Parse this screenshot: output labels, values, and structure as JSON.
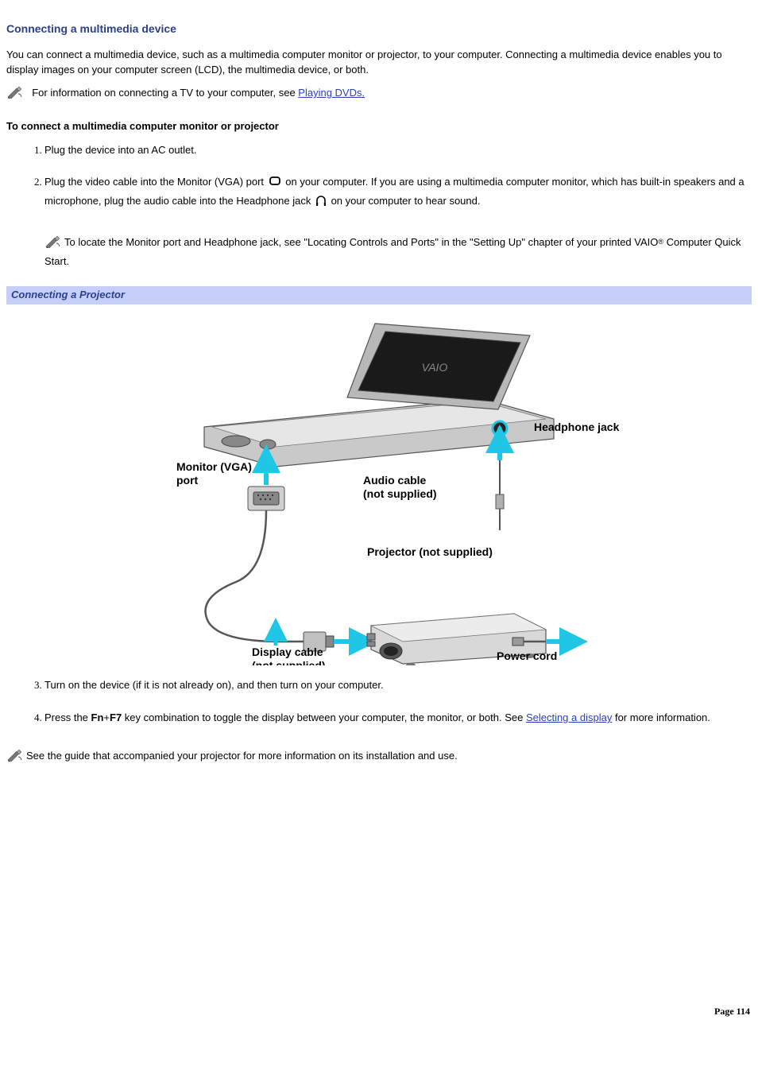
{
  "heading": "Connecting a multimedia device",
  "intro": "You can connect a multimedia device, such as a multimedia computer monitor or projector, to your computer. Connecting a multimedia device enables you to display images on your computer screen (LCD), the multimedia device, or both.",
  "tvNote_pre": "For information on connecting a TV to your computer, see ",
  "tvNote_link": "Playing DVDs.",
  "sectionTitle": "To connect a multimedia computer monitor or projector",
  "step1": "Plug the device into an AC outlet.",
  "step2_a": "Plug the video cable into the Monitor (VGA) port ",
  "step2_b": " on your computer. If you are using a multimedia computer monitor, which has built-in speakers and a microphone, plug the audio cable into the Headphone jack ",
  "step2_c": " on your computer to hear sound.",
  "step2_note_a": "To locate the Monitor port and Headphone jack, see \"Locating Controls and Ports\" in the \"Setting Up\" chapter of your printed VAIO",
  "step2_note_reg": "®",
  "step2_note_b": " Computer Quick Start.",
  "figureCaption": "Connecting a Projector",
  "diagram": {
    "monitorPort_l1": "Monitor (VGA)",
    "monitorPort_l2": "port",
    "headphoneJack": "Headphone jack",
    "audioCable_l1": "Audio cable",
    "audioCable_l2": "(not supplied)",
    "projector": "Projector (not supplied)",
    "displayCable_l1": "Display cable",
    "displayCable_l2": "(not supplied)",
    "powerCord": "Power cord"
  },
  "step3": "Turn on the device (if it is not already on), and then turn on your computer.",
  "step4_a": "Press the ",
  "step4_fn": "Fn",
  "step4_plus": "+",
  "step4_f7": "F7",
  "step4_b": " key combination to toggle the display between your computer, the monitor, or both. See ",
  "step4_link": "Selecting a display",
  "step4_c": " for more information.",
  "finalNote": "See the guide that accompanied your projector for more information on its installation and use.",
  "pageLabel": "Page 114"
}
